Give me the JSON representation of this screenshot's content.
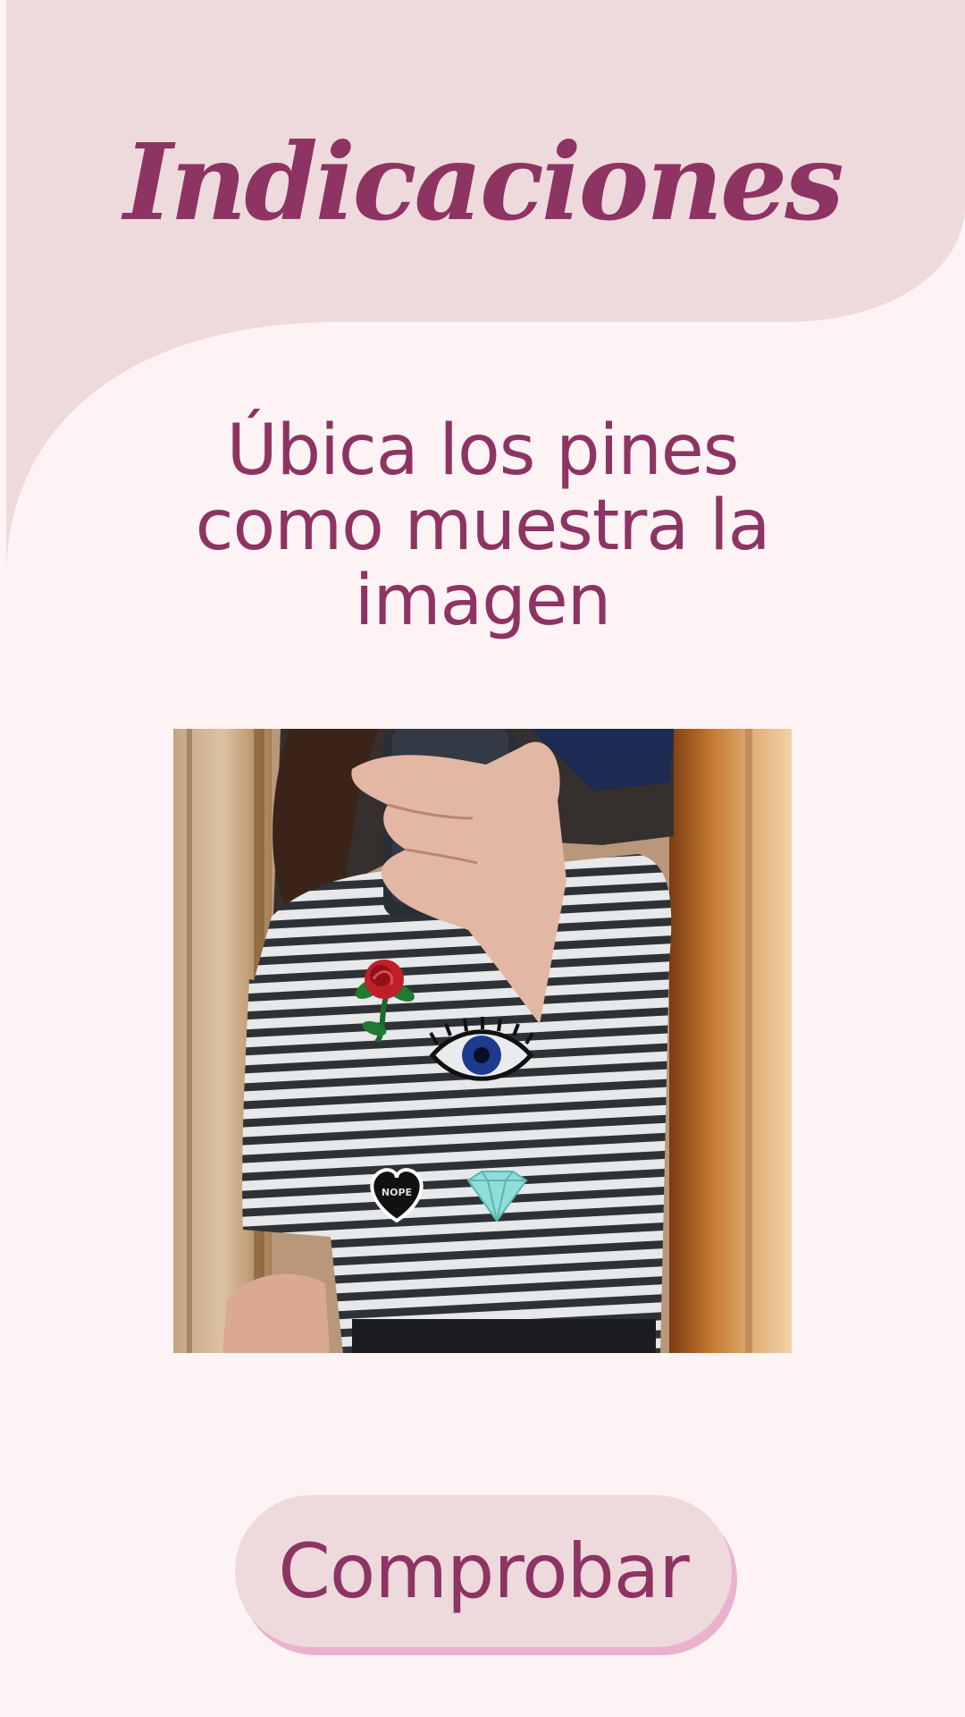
{
  "header": {
    "title": "Indicaciones"
  },
  "main": {
    "instruction": "Úbica los pines como muestra la imagen",
    "reference_image": {
      "pins": [
        "rose-pin",
        "eye-pin",
        "heart-pin",
        "diamond-pin"
      ],
      "heart_pin_text": "NOPE"
    }
  },
  "actions": {
    "check_label": "Comprobar"
  },
  "colors": {
    "background": "#fdf3f4",
    "header_shape": "#eed9dc",
    "accent_text": "#8d3463",
    "button_shadow": "#eab2cc"
  }
}
